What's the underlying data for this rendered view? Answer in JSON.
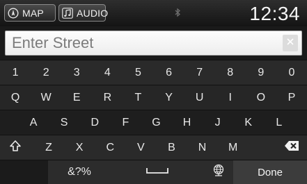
{
  "status_bar": {
    "map_label": "MAP",
    "audio_label": "AUDIO",
    "clock": "12:34"
  },
  "search": {
    "placeholder": "Enter Street",
    "value": ""
  },
  "keyboard": {
    "row_numbers": [
      "1",
      "2",
      "3",
      "4",
      "5",
      "6",
      "7",
      "8",
      "9",
      "0"
    ],
    "row_q": [
      "Q",
      "W",
      "E",
      "R",
      "T",
      "Y",
      "U",
      "I",
      "O",
      "P"
    ],
    "row_a": [
      "A",
      "S",
      "D",
      "F",
      "G",
      "H",
      "J",
      "K",
      "L"
    ],
    "row_z": [
      "Z",
      "X",
      "C",
      "V",
      "B",
      "N",
      "M"
    ],
    "symbols_label": "&?%",
    "done_label": "Done"
  },
  "icons": {
    "map": "compass-icon",
    "audio": "music-note-icon",
    "bluetooth": "bluetooth-icon",
    "clear": "close-icon",
    "shift": "shift-arrow-icon",
    "backspace": "backspace-icon",
    "space": "space-bar-icon",
    "language": "globe-icon"
  },
  "colors": {
    "background": "#222222",
    "key_text": "#e8e8e8",
    "input_bg": "#f4f4f4"
  }
}
